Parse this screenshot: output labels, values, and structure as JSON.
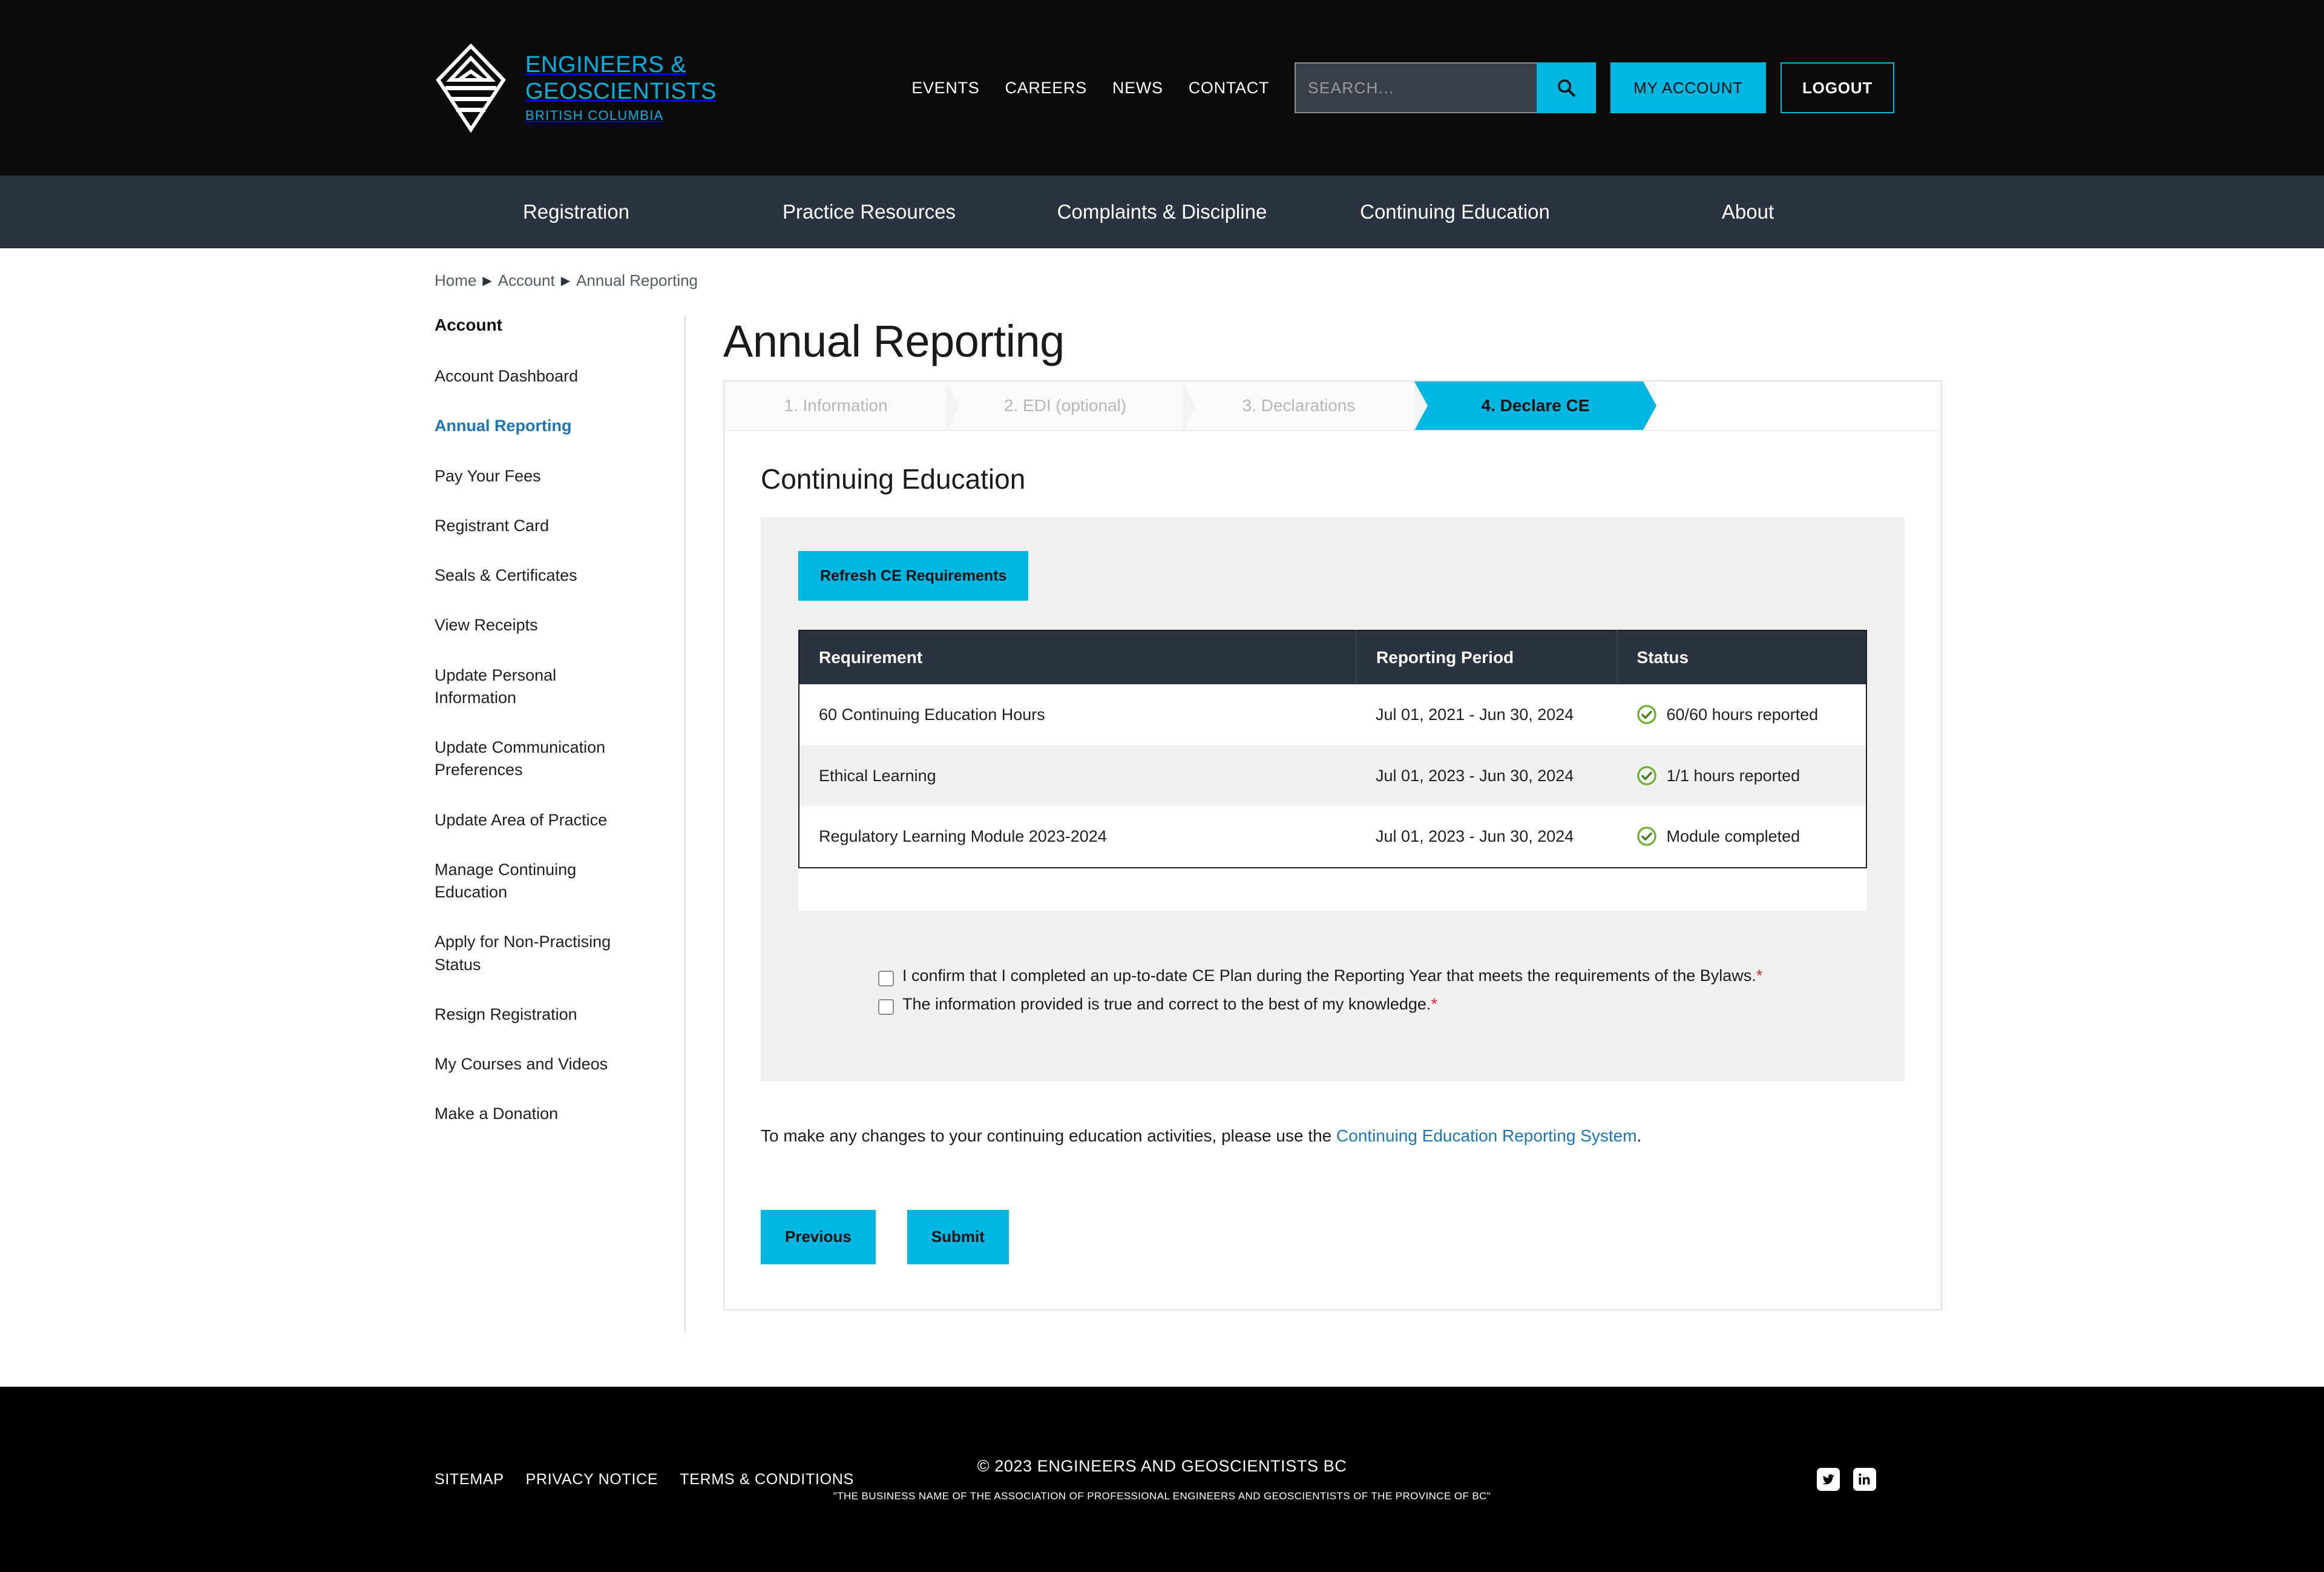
{
  "header": {
    "brand": {
      "line1": "ENGINEERS &",
      "line2": "GEOSCIENTISTS",
      "line3": "BRITISH COLUMBIA"
    },
    "utility_nav": [
      {
        "label": "EVENTS"
      },
      {
        "label": "CAREERS"
      },
      {
        "label": "NEWS"
      },
      {
        "label": "CONTACT"
      }
    ],
    "search": {
      "placeholder": "SEARCH...",
      "value": ""
    },
    "my_account_label": "MY ACCOUNT",
    "logout_label": "LOGOUT"
  },
  "main_nav": [
    {
      "label": "Registration"
    },
    {
      "label": "Practice Resources"
    },
    {
      "label": "Complaints & Discipline"
    },
    {
      "label": "Continuing Education"
    },
    {
      "label": "About"
    }
  ],
  "breadcrumb": [
    {
      "label": "Home"
    },
    {
      "label": "Account"
    },
    {
      "label": "Annual Reporting"
    }
  ],
  "sidebar": {
    "title": "Account",
    "items": [
      {
        "label": "Account Dashboard",
        "active": false
      },
      {
        "label": "Annual Reporting",
        "active": true
      },
      {
        "label": "Pay Your Fees",
        "active": false
      },
      {
        "label": "Registrant Card",
        "active": false
      },
      {
        "label": "Seals & Certificates",
        "active": false
      },
      {
        "label": "View Receipts",
        "active": false
      },
      {
        "label": "Update Personal Information",
        "active": false
      },
      {
        "label": "Update Communication Preferences",
        "active": false
      },
      {
        "label": "Update Area of Practice",
        "active": false
      },
      {
        "label": "Manage Continuing Education",
        "active": false
      },
      {
        "label": "Apply for Non-Practising Status",
        "active": false
      },
      {
        "label": "Resign Registration",
        "active": false
      },
      {
        "label": "My Courses and Videos",
        "active": false
      },
      {
        "label": "Make a Donation",
        "active": false
      }
    ]
  },
  "main": {
    "page_title": "Annual Reporting",
    "wizard": [
      {
        "label": "1. Information",
        "active": false
      },
      {
        "label": "2. EDI (optional)",
        "active": false
      },
      {
        "label": "3. Declarations",
        "active": false
      },
      {
        "label": "4. Declare CE",
        "active": true
      }
    ],
    "section_title": "Continuing Education",
    "refresh_label": "Refresh CE Requirements",
    "table": {
      "columns": [
        "Requirement",
        "Reporting Period",
        "Status"
      ],
      "rows": [
        {
          "requirement": "60 Continuing Education Hours",
          "period": "Jul 01, 2021 - Jun 30, 2024",
          "status": "60/60 hours reported",
          "status_icon": "check-circle-icon"
        },
        {
          "requirement": "Ethical Learning",
          "period": "Jul 01, 2023 - Jun 30, 2024",
          "status": "1/1 hours reported",
          "status_icon": "check-circle-icon"
        },
        {
          "requirement": "Regulatory Learning Module 2023-2024",
          "period": "Jul 01, 2023 - Jun 30, 2024",
          "status": "Module completed",
          "status_icon": "check-circle-icon"
        }
      ]
    },
    "checkboxes": [
      {
        "label": "I confirm that I completed an up-to-date CE Plan during the Reporting Year that meets the requirements of the Bylaws.",
        "required_marker": "*",
        "checked": false
      },
      {
        "label": "The information provided is true and correct to the best of my knowledge.",
        "required_marker": "*",
        "checked": false
      }
    ],
    "note": {
      "before": "To make any changes to your continuing education activities, please use the ",
      "link": "Continuing Education Reporting System",
      "after": "."
    },
    "previous_label": "Previous",
    "submit_label": "Submit"
  },
  "footer": {
    "links": [
      {
        "label": "SITEMAP"
      },
      {
        "label": "PRIVACY NOTICE"
      },
      {
        "label": "TERMS & CONDITIONS"
      }
    ],
    "copyright": "© 2023 ENGINEERS AND GEOSCIENTISTS BC",
    "legal": "\"THE BUSINESS NAME OF THE ASSOCIATION OF PROFESSIONAL ENGINEERS AND GEOSCIENTISTS OF THE PROVINCE OF BC\"",
    "social": [
      {
        "name": "twitter-icon"
      },
      {
        "name": "linkedin-icon"
      }
    ]
  },
  "colors": {
    "accent": "#00b7e2",
    "nav_bg": "#2b3240",
    "link": "#1b75bb",
    "success": "#6ab023",
    "required": "#e0262b"
  }
}
